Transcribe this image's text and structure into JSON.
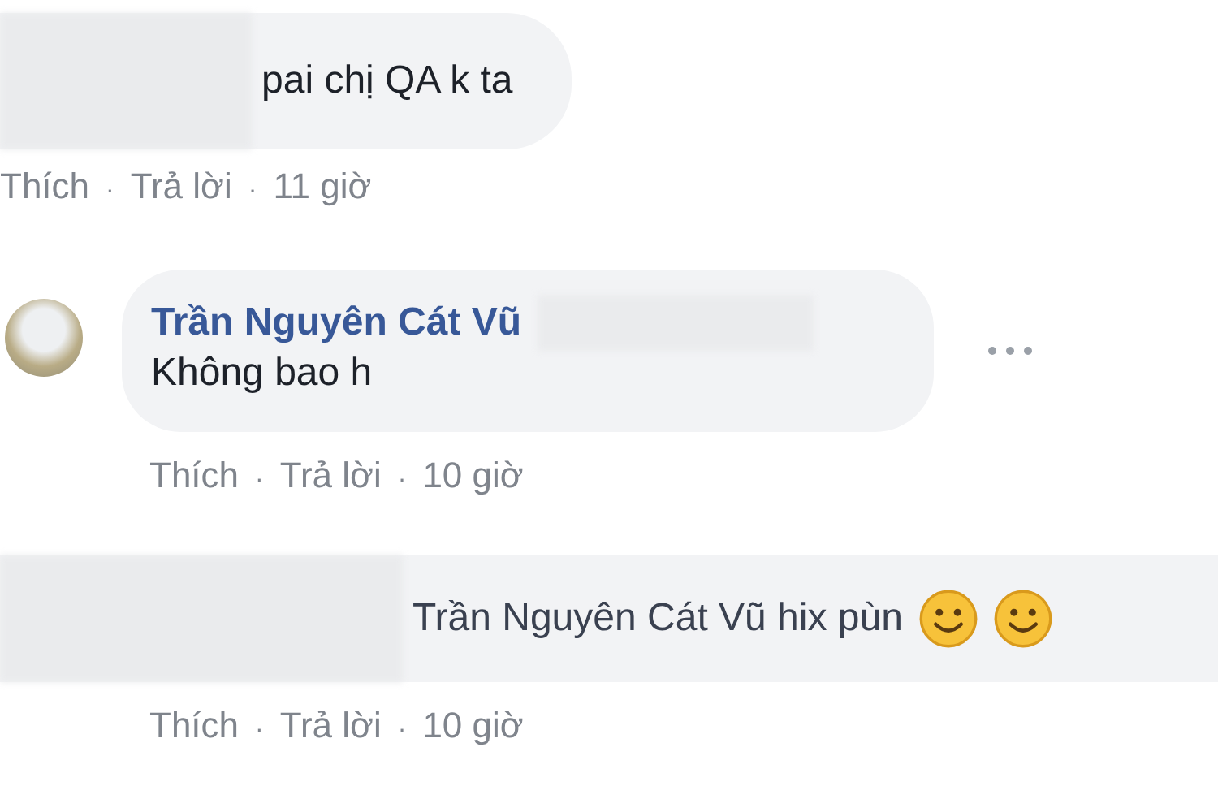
{
  "comments": [
    {
      "kind": "top",
      "author_hidden": true,
      "avatar": false,
      "text": "pai chị QA k ta",
      "menu": false,
      "actions": {
        "like": "Thích",
        "separator_1": "·",
        "reply": "Trả lời",
        "separator_2": "·",
        "time": "11 giờ"
      }
    },
    {
      "kind": "reply",
      "author_hidden": false,
      "avatar": true,
      "author": "Trần Nguyên Cát Vũ",
      "text": "Không bao h",
      "menu": true,
      "actions": {
        "like": "Thích",
        "separator_1": "·",
        "reply": "Trả lời",
        "separator_2": "·",
        "time": "10 giờ"
      }
    },
    {
      "kind": "reply",
      "author_hidden": true,
      "avatar": false,
      "text": "Trần Nguyên Cát Vũ hix pùn",
      "reactions": [
        {
          "kind": "smiley"
        },
        {
          "kind": "smiley"
        }
      ],
      "menu": false,
      "actions": {
        "like": "Thích",
        "separator_1": "·",
        "reply": "Trả lời",
        "separator_2": "·",
        "time": "10 giờ"
      }
    }
  ]
}
